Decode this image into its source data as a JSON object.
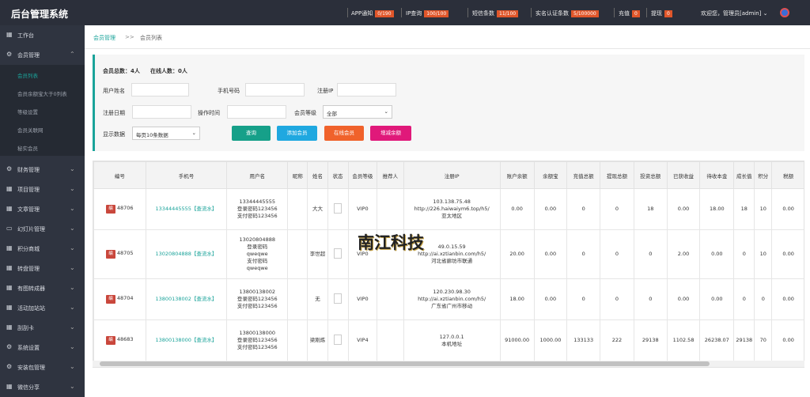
{
  "header": {
    "brand": "后台管理系统",
    "stats": [
      {
        "label": "APP通知",
        "badge": "0/190"
      },
      {
        "label": "IP查询",
        "badge": "100/100"
      },
      {
        "label": "短信条数",
        "badge": "11/100"
      },
      {
        "label": "实名认证条数",
        "badge": "5/100000"
      },
      {
        "label": "充值",
        "badge": "0"
      },
      {
        "label": "提现",
        "badge": "0"
      }
    ],
    "welcome": "欢迎您，管理员[admin]"
  },
  "sidebar": {
    "items": [
      {
        "label": "工作台"
      },
      {
        "label": "会员管理"
      },
      {
        "label": "财务管理"
      },
      {
        "label": "项目管理"
      },
      {
        "label": "文章管理"
      },
      {
        "label": "幻灯片管理"
      },
      {
        "label": "积分商城"
      },
      {
        "label": "转盘管理"
      },
      {
        "label": "有图转成器"
      },
      {
        "label": "活动加站站"
      },
      {
        "label": "刮刮卡"
      },
      {
        "label": "系统设置"
      },
      {
        "label": "安装包管理"
      },
      {
        "label": "微信分享"
      }
    ],
    "subitems": [
      {
        "label": "会员列表"
      },
      {
        "label": "会员余额宝大于0列表"
      },
      {
        "label": "等级设置"
      },
      {
        "label": "会员关联网"
      },
      {
        "label": "秘实会员"
      }
    ]
  },
  "breadcrumb": {
    "root": "会员管理",
    "sep": ">>",
    "current": "会员列表"
  },
  "filters": {
    "total_label": "会员总数：4人",
    "online_label": "在线人数：0人",
    "username_label": "用户姓名",
    "phone_label": "手机号码",
    "ip_label": "注册IP",
    "regdate_label": "注册日期",
    "optime_label": "操作时间",
    "level_label": "会员等级",
    "level_value": "全部",
    "display_label": "显示数据",
    "display_value": "每页10条数据",
    "buttons": {
      "query": "查询",
      "add": "添加会员",
      "online": "在线会员",
      "topup": "增减余额"
    }
  },
  "table": {
    "columns": [
      "编号",
      "手机号",
      "用户名",
      "昵称",
      "姓名",
      "状态",
      "会员等级",
      "推荐人",
      "注册IP",
      "账户余额",
      "余额宝",
      "充值总额",
      "提现总额",
      "投资总额",
      "已获收益",
      "待收本金",
      "成长值",
      "积分",
      "税额"
    ],
    "edit_label": "编",
    "rows": [
      {
        "id": "48706",
        "phone": "13344445555【查流水】",
        "username": [
          "13344445555",
          "登录密码123456",
          "支付密码123456"
        ],
        "nickname": "",
        "name": "大大",
        "level": "VIP0",
        "referrer": "",
        "ip": [
          "103.138.75.48",
          "http://226.haiwaiym6.top/h5/",
          "亚太地区"
        ],
        "balance": "0.00",
        "yuebao": "0.00",
        "recharge": "0",
        "withdraw": "0",
        "invest": "18",
        "income": "0.00",
        "principal": "18.00",
        "growth": "18",
        "points": "10",
        "tax": "0.00"
      },
      {
        "id": "48705",
        "phone": "13020804888【查流水】",
        "username": [
          "13020804888",
          "登录密码",
          "qweqwe",
          "支付密码",
          "qweqwe"
        ],
        "nickname": "",
        "name": "李世超",
        "level": "VIP0",
        "referrer": "",
        "ip": [
          "49.0.15.59",
          "http://ai.xztianbin.com/h5/",
          "河北省廊坊市联通"
        ],
        "balance": "20.00",
        "yuebao": "0.00",
        "recharge": "0",
        "withdraw": "0",
        "invest": "0",
        "income": "2.00",
        "principal": "0.00",
        "growth": "0",
        "points": "10",
        "tax": "0.00"
      },
      {
        "id": "48704",
        "phone": "13800138002【查流水】",
        "username": [
          "13800138002",
          "登录密码123456",
          "支付密码123456"
        ],
        "nickname": "",
        "name": "无",
        "level": "VIP0",
        "referrer": "",
        "ip": [
          "120.230.98.30",
          "http://ai.xztianbin.com/h5/",
          "广东省广州市移动"
        ],
        "balance": "18.00",
        "yuebao": "0.00",
        "recharge": "0",
        "withdraw": "0",
        "invest": "0",
        "income": "0.00",
        "principal": "0.00",
        "growth": "0",
        "points": "0",
        "tax": "0.00"
      },
      {
        "id": "48683",
        "phone": "13800138000【查流水】",
        "username": [
          "13800138000",
          "登录密码123456",
          "支付密码123456"
        ],
        "nickname": "",
        "name": "梁刚炼",
        "level": "VIP4",
        "referrer": "",
        "ip": [
          "127.0.0.1",
          "",
          "本机地址"
        ],
        "balance": "91000.00",
        "yuebao": "1000.00",
        "recharge": "133133",
        "withdraw": "222",
        "invest": "29138",
        "income": "1102.58",
        "principal": "26238.07",
        "growth": "29138",
        "points": "70",
        "tax": "0.00"
      }
    ]
  },
  "watermark": "南江科技"
}
